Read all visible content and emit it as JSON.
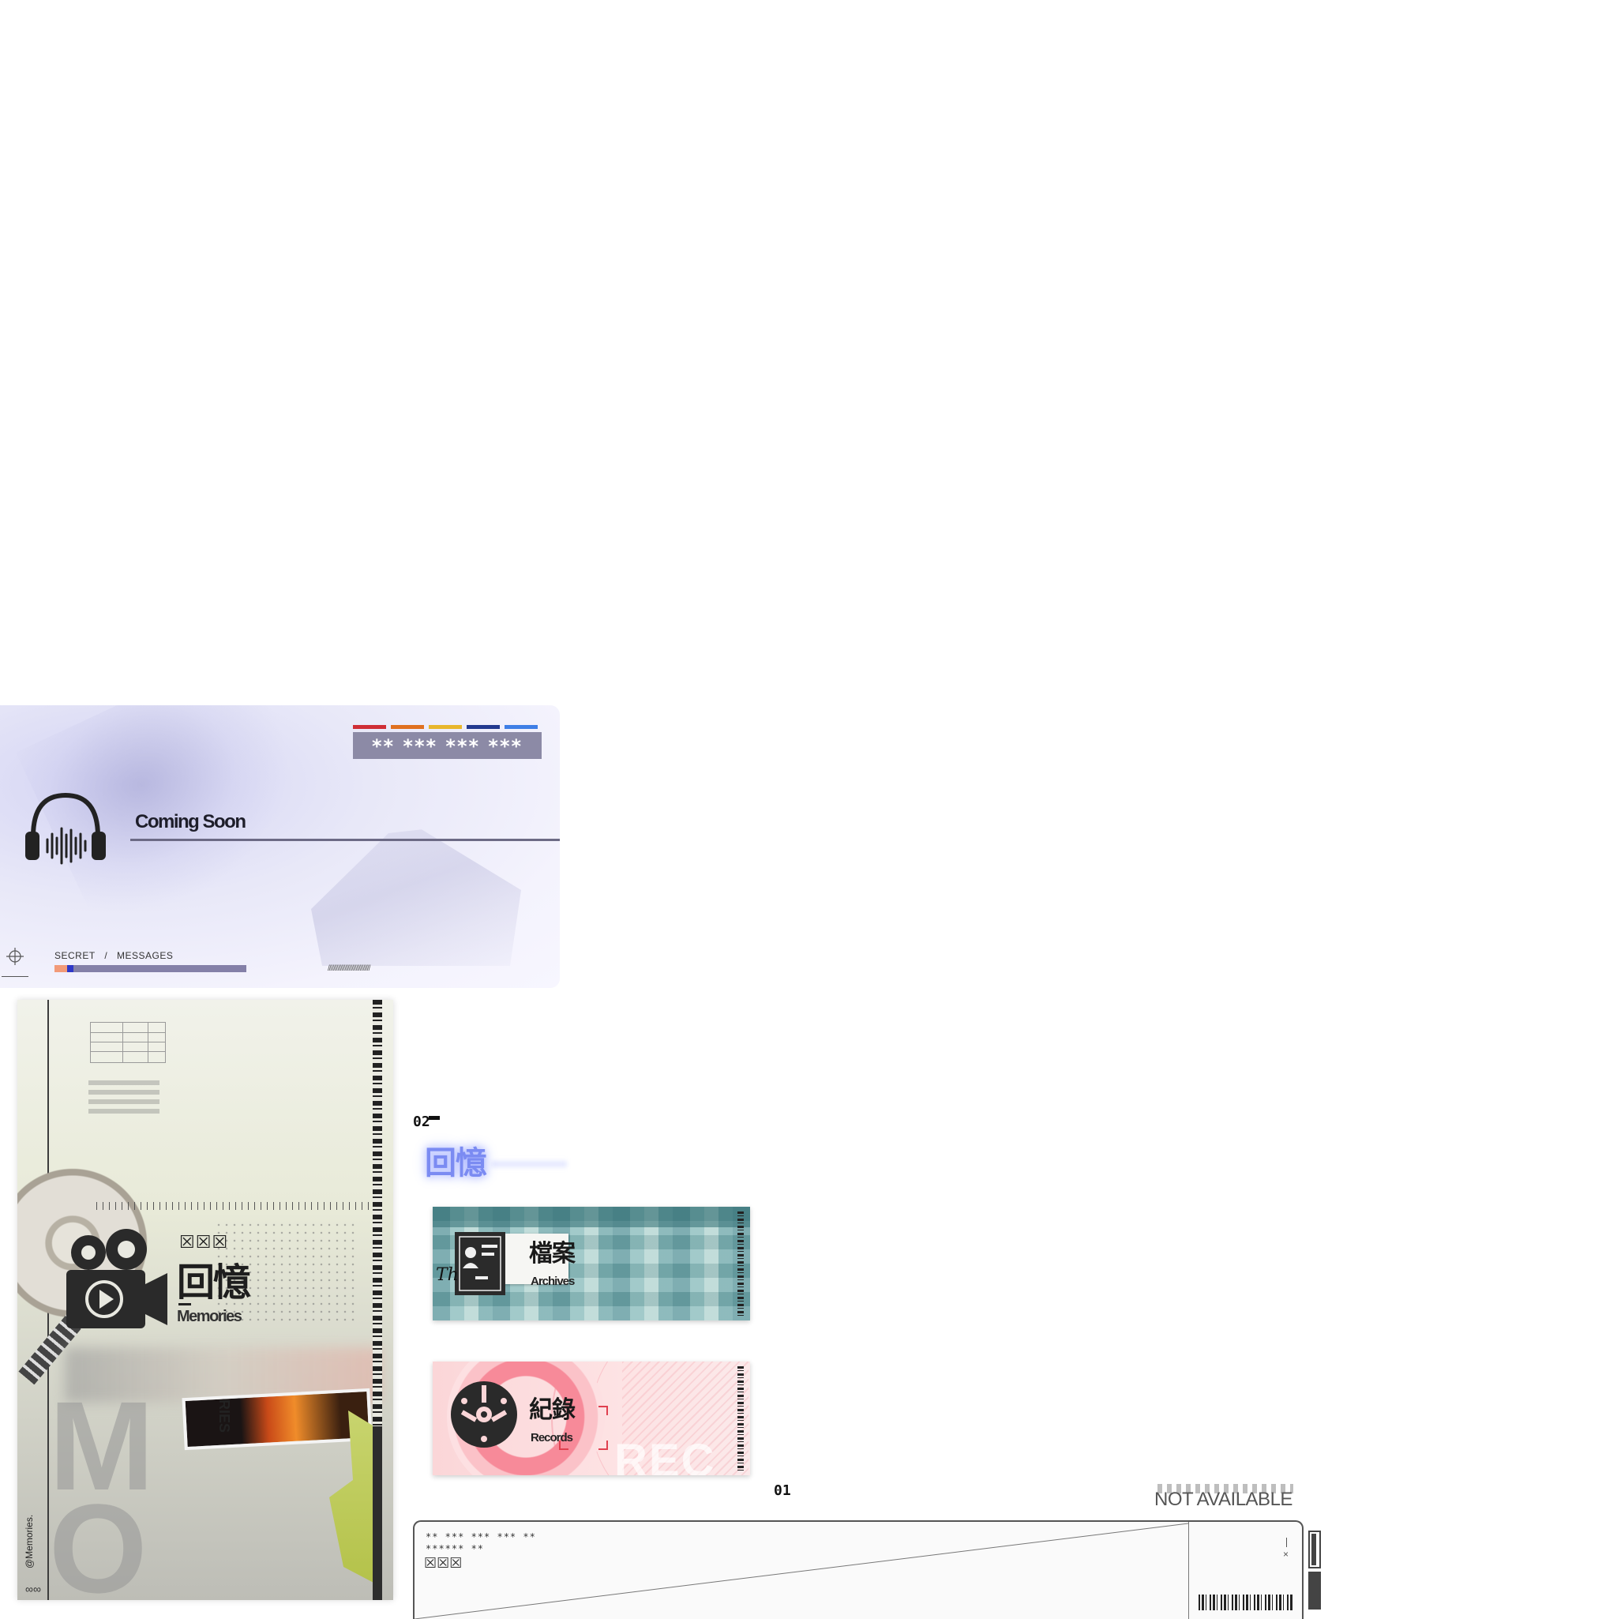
{
  "banner": {
    "masked_text": "** *** *** ***",
    "title": "Coming Soon",
    "breadcrumb": [
      "SECRET",
      "/",
      "MESSAGES"
    ],
    "progress": 0.1,
    "hatch": "//////////////////////////////",
    "color_bars": [
      "#cf2e36",
      "#e0701f",
      "#e8b62c",
      "#233a8f",
      "#3f7fe6"
    ],
    "icons": [
      "headphone-icon",
      "crosshair-icon"
    ]
  },
  "memories_card": {
    "boxed_label": "☒☒☒",
    "title_cn": "回憶",
    "title_en": "Memories",
    "photo_text": "RIES",
    "handle": "@Memories.",
    "infinity": "∞∞",
    "icons": [
      "camera-icon",
      "film-reel-icon"
    ]
  },
  "section_02": {
    "number": "02",
    "glow_title": "回憶"
  },
  "cards": [
    {
      "title_cn": "檔案",
      "title_en": "Archives",
      "signature": "Th",
      "icon": "id-card-icon"
    },
    {
      "title_cn": "紀錄",
      "title_en": "Records",
      "ghost_text": "REC",
      "icon": "film-reel-icon"
    }
  ],
  "section_01": {
    "number": "01"
  },
  "not_available": {
    "title": "NOT AVAILABLE",
    "masked_line1": "** *** *** *** **",
    "masked_line2": "****** **",
    "boxed": "☒☒☒",
    "close": "×"
  },
  "colors": {
    "banner_accent": "#8c8aa6",
    "progress_orange": "#f29a78",
    "progress_blue": "#2e37c8",
    "glow": "#7b8bf2",
    "archives_teal": "#6da3a7",
    "records_pink": "#f78a99"
  }
}
